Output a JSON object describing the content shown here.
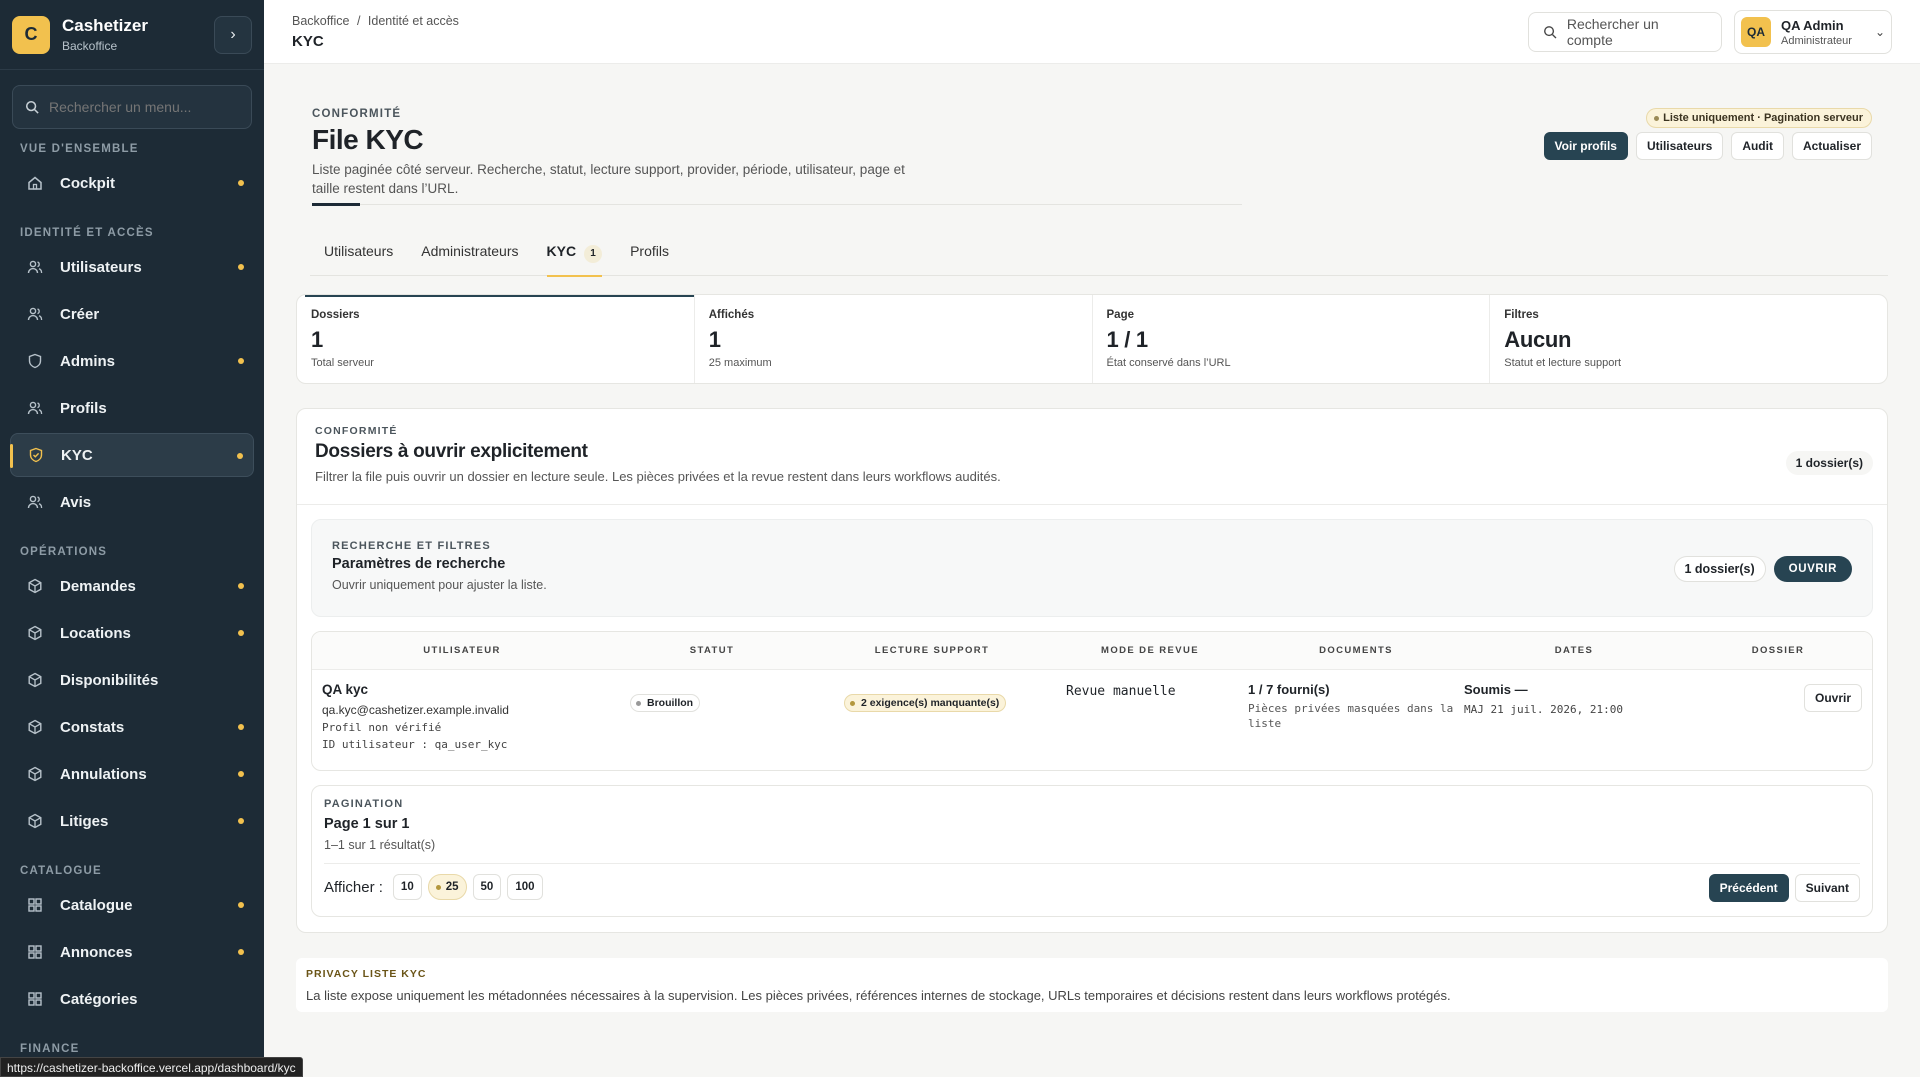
{
  "brand": {
    "logo_letter": "C",
    "name": "Cashetizer",
    "sub": "Backoffice"
  },
  "sidebar": {
    "search_placeholder": "Rechercher un menu...",
    "sections": [
      {
        "title": "Vue d'ensemble",
        "items": [
          {
            "label": "Cockpit",
            "icon": "home-icon",
            "dot": true
          }
        ]
      },
      {
        "title": "Identité et accès",
        "items": [
          {
            "label": "Utilisateurs",
            "icon": "users-icon",
            "dot": true
          },
          {
            "label": "Créer",
            "icon": "users-icon",
            "dot": false
          },
          {
            "label": "Admins",
            "icon": "shield-icon",
            "dot": true
          },
          {
            "label": "Profils",
            "icon": "users-icon",
            "dot": false
          },
          {
            "label": "KYC",
            "icon": "shield-check-icon",
            "dot": true,
            "active": true
          },
          {
            "label": "Avis",
            "icon": "users-icon",
            "dot": false
          }
        ]
      },
      {
        "title": "Opérations",
        "items": [
          {
            "label": "Demandes",
            "icon": "cube-icon",
            "dot": true
          },
          {
            "label": "Locations",
            "icon": "cube-icon",
            "dot": true
          },
          {
            "label": "Disponibilités",
            "icon": "cube-icon",
            "dot": false
          },
          {
            "label": "Constats",
            "icon": "cube-icon",
            "dot": true
          },
          {
            "label": "Annulations",
            "icon": "cube-icon",
            "dot": true
          },
          {
            "label": "Litiges",
            "icon": "cube-icon",
            "dot": true
          }
        ]
      },
      {
        "title": "Catalogue",
        "items": [
          {
            "label": "Catalogue",
            "icon": "grid-icon",
            "dot": true
          },
          {
            "label": "Annonces",
            "icon": "grid-icon",
            "dot": true
          },
          {
            "label": "Catégories",
            "icon": "grid-icon",
            "dot": false
          }
        ]
      },
      {
        "title": "Finance",
        "items": []
      }
    ]
  },
  "status_url": "https://cashetizer-backoffice.vercel.app/dashboard/kyc",
  "header": {
    "breadcrumb": [
      "Backoffice",
      "/",
      "Identité et accès"
    ],
    "title": "KYC",
    "account_search_placeholder": "Rechercher un compte",
    "user": {
      "initials": "QA",
      "name": "QA Admin",
      "role": "Administrateur"
    }
  },
  "hero": {
    "eyebrow": "Conformité",
    "title": "File KYC",
    "desc": "Liste paginée côté serveur. Recherche, statut, lecture support, provider, période, utilisateur, page et taille restent dans l’URL.",
    "note": "Liste uniquement · Pagination serveur",
    "actions": [
      "Voir profils",
      "Utilisateurs",
      "Audit",
      "Actualiser"
    ]
  },
  "tabs": [
    {
      "label": "Utilisateurs"
    },
    {
      "label": "Administrateurs"
    },
    {
      "label": "KYC",
      "badge": "1",
      "active": true
    },
    {
      "label": "Profils"
    }
  ],
  "stats": [
    {
      "label": "Dossiers",
      "value": "1",
      "sub": "Total serveur"
    },
    {
      "label": "Affichés",
      "value": "1",
      "sub": "25 maximum"
    },
    {
      "label": "Page",
      "value": "1 / 1",
      "sub": "État conservé dans l’URL"
    },
    {
      "label": "Filtres",
      "value": "Aucun",
      "sub": "Statut et lecture support"
    }
  ],
  "panel": {
    "eyebrow": "Conformité",
    "title": "Dossiers à ouvrir explicitement",
    "desc": "Filtrer la file puis ouvrir un dossier en lecture seule. Les pièces privées et la revue restent dans leurs workflows audités.",
    "count": "1 dossier(s)"
  },
  "filters": {
    "eyebrow": "Recherche et filtres",
    "title": "Paramètres de recherche",
    "desc": "Ouvrir uniquement pour ajuster la liste.",
    "count": "1 dossier(s)",
    "open_label": "OUVRIR"
  },
  "table": {
    "headers": [
      "Utilisateur",
      "Statut",
      "Lecture support",
      "Mode de revue",
      "Documents",
      "Dates",
      "Dossier"
    ],
    "rows": [
      {
        "name": "QA kyc",
        "email": "qa.kyc@cashetizer.example.invalid",
        "profile": "Profil non vérifié",
        "uid": "ID utilisateur : qa_user_kyc",
        "status": "Brouillon",
        "support": "2 exigence(s) manquante(s)",
        "mode": "Revue manuelle",
        "docs": "1 / 7 fourni(s)",
        "docs_sub": "Pièces privées masquées dans la liste",
        "date_main": "Soumis —",
        "date_sub": "MAJ 21 juil. 2026, 21:00",
        "action": "Ouvrir"
      }
    ]
  },
  "pagination": {
    "eyebrow": "Pagination",
    "title": "Page 1 sur 1",
    "sub": "1–1 sur 1 résultat(s)",
    "show_label": "Afficher :",
    "sizes": [
      "10",
      "25",
      "50",
      "100"
    ],
    "selected": "25",
    "prev": "Précédent",
    "next": "Suivant"
  },
  "privacy": {
    "title": "Privacy liste KYC",
    "text": "La liste expose uniquement les métadonnées nécessaires à la supervision. Les pièces privées, références internes de stockage, URLs temporaires et décisions restent dans leurs workflows protégés."
  },
  "colors": {
    "accent": "#f2c14e",
    "sidebar": "#1d2b36",
    "primary": "#274452"
  }
}
